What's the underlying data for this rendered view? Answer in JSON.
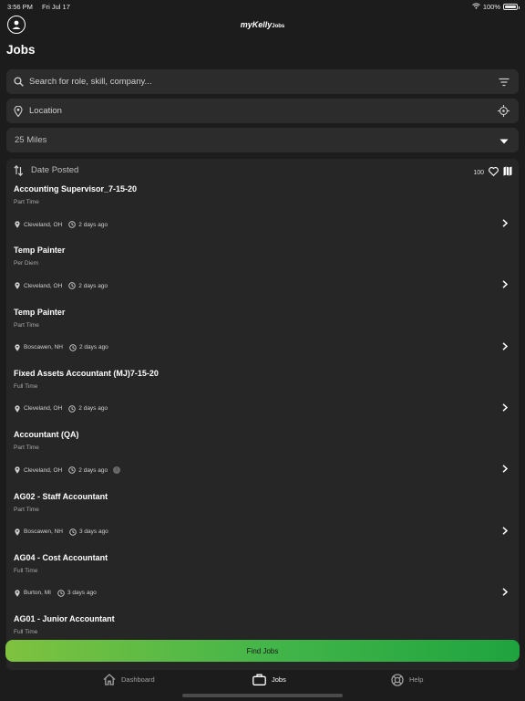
{
  "status": {
    "time": "3:56 PM",
    "date": "Fri Jul 17",
    "battery": "100%",
    "battery_level": 1.0
  },
  "brand": {
    "name": "myKelly",
    "suffix": "Jobs"
  },
  "page": {
    "title": "Jobs"
  },
  "search": {
    "placeholder": "Search for role, skill, company..."
  },
  "location": {
    "placeholder": "Location"
  },
  "radius": {
    "selected": "25 Miles"
  },
  "sort": {
    "label": "Date Posted",
    "count": "100"
  },
  "jobs": [
    {
      "title": "Accounting Supervisor_7-15-20",
      "type": "Part Time",
      "location": "Cleveland, OH",
      "posted": "2 days ago"
    },
    {
      "title": "Temp Painter",
      "type": "Per Diem",
      "location": "Cleveland, OH",
      "posted": "2 days ago"
    },
    {
      "title": "Temp Painter",
      "type": "Part Time",
      "location": "Boscawen, NH",
      "posted": "2 days ago"
    },
    {
      "title": "Fixed Assets Accountant (MJ)7-15-20",
      "type": "Full Time",
      "location": "Cleveland, OH",
      "posted": "2 days ago"
    },
    {
      "title": "Accountant (QA)",
      "type": "Part Time",
      "location": "Cleveland, OH",
      "posted": "2 days ago",
      "info_icon": true
    },
    {
      "title": "AG02 - Staff Accountant",
      "type": "Part Time",
      "location": "Boscawen, NH",
      "posted": "3 days ago"
    },
    {
      "title": "AG04 - Cost Accountant",
      "type": "Full Time",
      "location": "Burton, MI",
      "posted": "3 days ago"
    },
    {
      "title": "AG01 - Junior Accountant",
      "type": "Full Time",
      "location": "",
      "posted": ""
    }
  ],
  "actions": {
    "find_jobs": "Find Jobs"
  },
  "tabs": [
    {
      "label": "Dashboard",
      "icon": "home-icon",
      "active": false
    },
    {
      "label": "Jobs",
      "icon": "briefcase-icon",
      "active": true
    },
    {
      "label": "Help",
      "icon": "lifebuoy-icon",
      "active": false
    }
  ],
  "colors": {
    "background": "#1c1c1c",
    "panel": "#262626",
    "field": "#2c2c2c",
    "accent_start": "#7fc23f",
    "accent_end": "#1fa33f"
  }
}
